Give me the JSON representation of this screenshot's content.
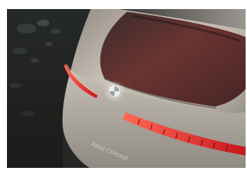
{
  "image": {
    "subject": "car-rear",
    "colors": {
      "page_background": "#ffffff",
      "ground": "#2a2d2b",
      "body_paint": "#c9c3b8",
      "body_shadow": "#4b4845",
      "glass": "#5a2f2c",
      "taillight_red": "#e0262a",
      "taillight_glow": "#ff5a4a",
      "badge": "#f2f2f2"
    },
    "rear_lettering": "iNext Concept"
  }
}
